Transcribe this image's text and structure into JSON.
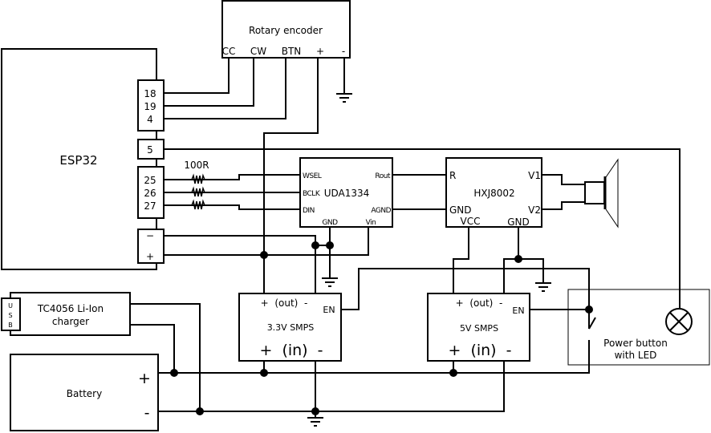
{
  "esp32": {
    "label": "ESP32",
    "pins_a": [
      "18",
      "19",
      "4"
    ],
    "pin_5": "5",
    "pins_b": [
      "25",
      "26",
      "27"
    ],
    "pwr_minus": "−",
    "pwr_plus": "+"
  },
  "resistor": {
    "label": "100R"
  },
  "encoder": {
    "title": "Rotary encoder",
    "pins": [
      "CC",
      "CW",
      "BTN",
      "+",
      "-"
    ]
  },
  "dac": {
    "title": "UDA1334",
    "wsel": "WSEL",
    "bclk": "BCLK",
    "din": "DIN",
    "rout": "Rout",
    "agnd": "AGND",
    "gnd": "GND",
    "vin": "Vin"
  },
  "amp": {
    "title": "HXJ8002",
    "r": "R",
    "gnd_in": "GND",
    "vcc": "VCC",
    "gnd": "GND",
    "v1": "V1",
    "v2": "V2"
  },
  "smps33": {
    "title": "3.3V SMPS",
    "out": "+  (out)  -",
    "en": "EN",
    "in": "+  (in)  -"
  },
  "smps5": {
    "title": "5V SMPS",
    "out": "+  (out)  -",
    "en": "EN",
    "in": "+  (in)  -"
  },
  "charger": {
    "title_1": "TC4056 Li-Ion",
    "title_2": "charger",
    "usb": [
      "U",
      "S",
      "B"
    ]
  },
  "battery": {
    "title": "Battery",
    "plus": "+",
    "minus": "-"
  },
  "power_button": {
    "title_1": "Power button",
    "title_2": "with LED"
  }
}
